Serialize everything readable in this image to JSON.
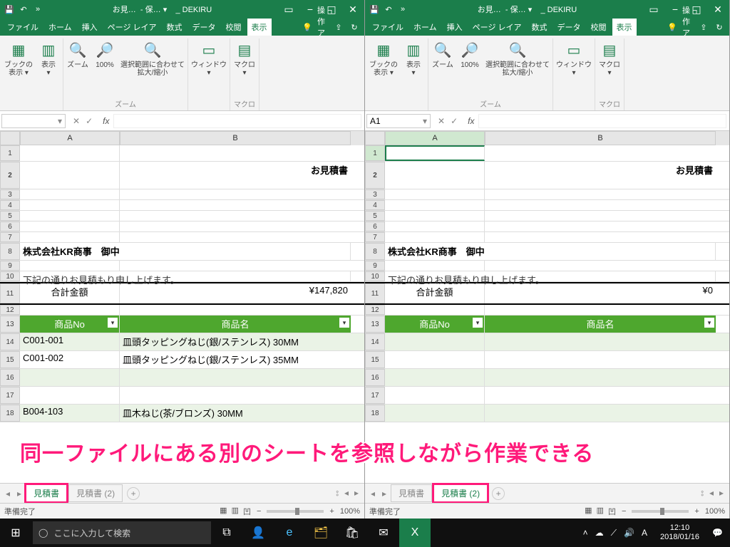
{
  "overlay": "同一ファイルにある別のシートを参照しながら作業できる",
  "title": {
    "doc": "お見…",
    "saved": "- 保… ▾",
    "app": "_ DEKIRU"
  },
  "tabs": {
    "file": "ファイル",
    "home": "ホーム",
    "insert": "挿入",
    "layout": "ページ レイア",
    "formula": "数式",
    "data": "データ",
    "review": "校閲",
    "view": "表示",
    "tell": "操作アシ"
  },
  "ribbon": {
    "bookview": "ブックの\n表示 ▾",
    "show": "表示\n▾",
    "zoom": "ズーム",
    "p100": "100%",
    "fitsel": "選択範囲に合わせて\n拡大/縮小",
    "window": "ウィンドウ\n▾",
    "macro": "マクロ\n▾",
    "grp_zoom": "ズーム",
    "grp_macro": "マクロ"
  },
  "fbar": {
    "cellref_left": "",
    "cellref_right": "A1",
    "fx": "fx"
  },
  "cols": {
    "A": "A",
    "B": "B"
  },
  "sheet": {
    "title": "お見積書",
    "company": "株式会社KR商事　御中",
    "note": "下記の通りお見積もり申し上げます。",
    "total_label": "合計金額",
    "total_left": "¥147,820",
    "total_right": "¥0",
    "hdr_no": "商品No",
    "hdr_name": "商品名"
  },
  "rows_left": [
    {
      "r": "14",
      "no": "C001-001",
      "name": "皿頭タッピングねじ(銀/ステンレス) 30MM"
    },
    {
      "r": "15",
      "no": "C001-002",
      "name": "皿頭タッピングねじ(銀/ステンレス) 35MM"
    },
    {
      "r": "16",
      "no": "",
      "name": ""
    },
    {
      "r": "17",
      "no": "",
      "name": ""
    },
    {
      "r": "18",
      "no": "B004-103",
      "name": "皿木ねじ(茶/ブロンズ) 30MM"
    }
  ],
  "rows_right": [
    {
      "r": "14",
      "no": "",
      "name": ""
    },
    {
      "r": "15",
      "no": "",
      "name": ""
    },
    {
      "r": "16",
      "no": "",
      "name": ""
    },
    {
      "r": "17",
      "no": "",
      "name": ""
    },
    {
      "r": "18",
      "no": "",
      "name": ""
    }
  ],
  "sheettabs": {
    "s1": "見積書",
    "s2": "見積書 (2)"
  },
  "status": {
    "ready": "準備完了",
    "zoom": "100%"
  },
  "taskbar": {
    "search": "ここに入力して検索",
    "time": "12:10",
    "date": "2018/01/16"
  }
}
